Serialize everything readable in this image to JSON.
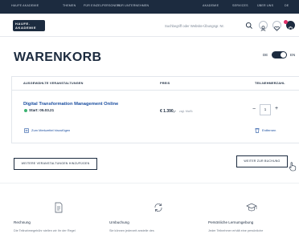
{
  "topbar": {
    "items": [
      "HAUFE AKADEMIE",
      "THEMEN",
      "FÜR EINZELPERSONEN",
      "FÜR UNTERNEHMEN",
      "AKADEMIE",
      "SERVICES",
      "ÜBER UNS",
      "DE"
    ]
  },
  "header": {
    "logo_line1": "HAUFE.",
    "logo_line2": "AKADEMIE",
    "search_placeholder": "Suchbegriff oder Website-Übungsgr. Nr.",
    "cart_badge_color": "#e0306a"
  },
  "page": {
    "title": "WARENKORB",
    "lang_de": "DE",
    "lang_en": "EN"
  },
  "cart": {
    "columns": [
      "AUSGEWÄHLTE VERANSTALTUNGEN",
      "PREIS",
      "TEILNEHMERZAHL"
    ],
    "item": {
      "title": "Digital Transformation Management Online",
      "start": "Start: 05.03.21",
      "price": "€ 1.390,-",
      "price_note": "zzgl. MwSt.",
      "quantity": "1",
      "memo_link": "Zum Merkzettel hinzufügen",
      "remove_link": "Entfernen"
    }
  },
  "actions": {
    "more_events": "WEITERE VERANSTALTUNGEN HINZUFÜGEN",
    "to_booking": "WEITER ZUR BUCHUNG"
  },
  "info": [
    {
      "title": "Rechnung",
      "text": "Die Teilnahmegebühr stellen wir Ihr der Regel"
    },
    {
      "title": "Umbuchung",
      "text": "Sie können jederzeit anstelle des"
    },
    {
      "title": "Persönliche Lernumgebung",
      "text": "Jeder Teilnehmer erhält eine persönliche"
    }
  ],
  "colors": {
    "navy": "#1c2b3f",
    "link_blue": "#1c4fa0",
    "status_green": "#3cb371"
  }
}
